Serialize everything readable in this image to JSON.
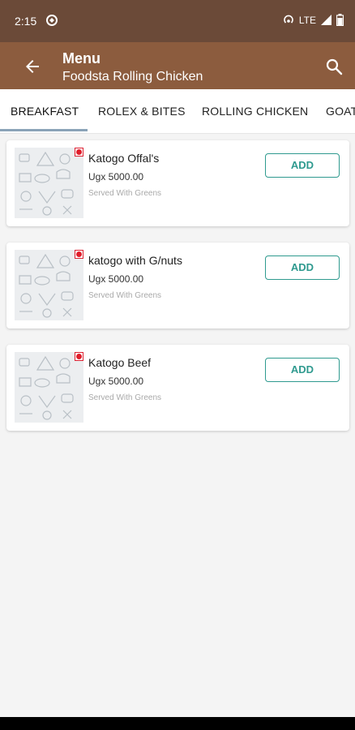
{
  "status_bar": {
    "time": "2:15",
    "network": "LTE"
  },
  "app_bar": {
    "title": "Menu",
    "subtitle": "Foodsta Rolling Chicken",
    "back_icon": "arrow-left-icon",
    "search_icon": "search-icon"
  },
  "tabs": [
    {
      "label": "BREAKFAST",
      "active": true
    },
    {
      "label": "ROLEX & BITES",
      "active": false
    },
    {
      "label": "ROLLING CHICKEN",
      "active": false
    },
    {
      "label": "GOAT",
      "active": false
    }
  ],
  "items": [
    {
      "name": "Katogo Offal's",
      "price": "Ugx 5000.00",
      "description": "Served With Greens",
      "button": "ADD"
    },
    {
      "name": "katogo with G/nuts",
      "price": "Ugx 5000.00",
      "description": "Served With Greens",
      "button": "ADD"
    },
    {
      "name": "Katogo Beef",
      "price": "Ugx 5000.00",
      "description": "Served With Greens",
      "button": "ADD"
    }
  ],
  "colors": {
    "status_bar": "#6b4a38",
    "app_bar": "#8c5c3e",
    "accent": "#2f9a8f",
    "non_veg_dot": "#e01e2b"
  }
}
